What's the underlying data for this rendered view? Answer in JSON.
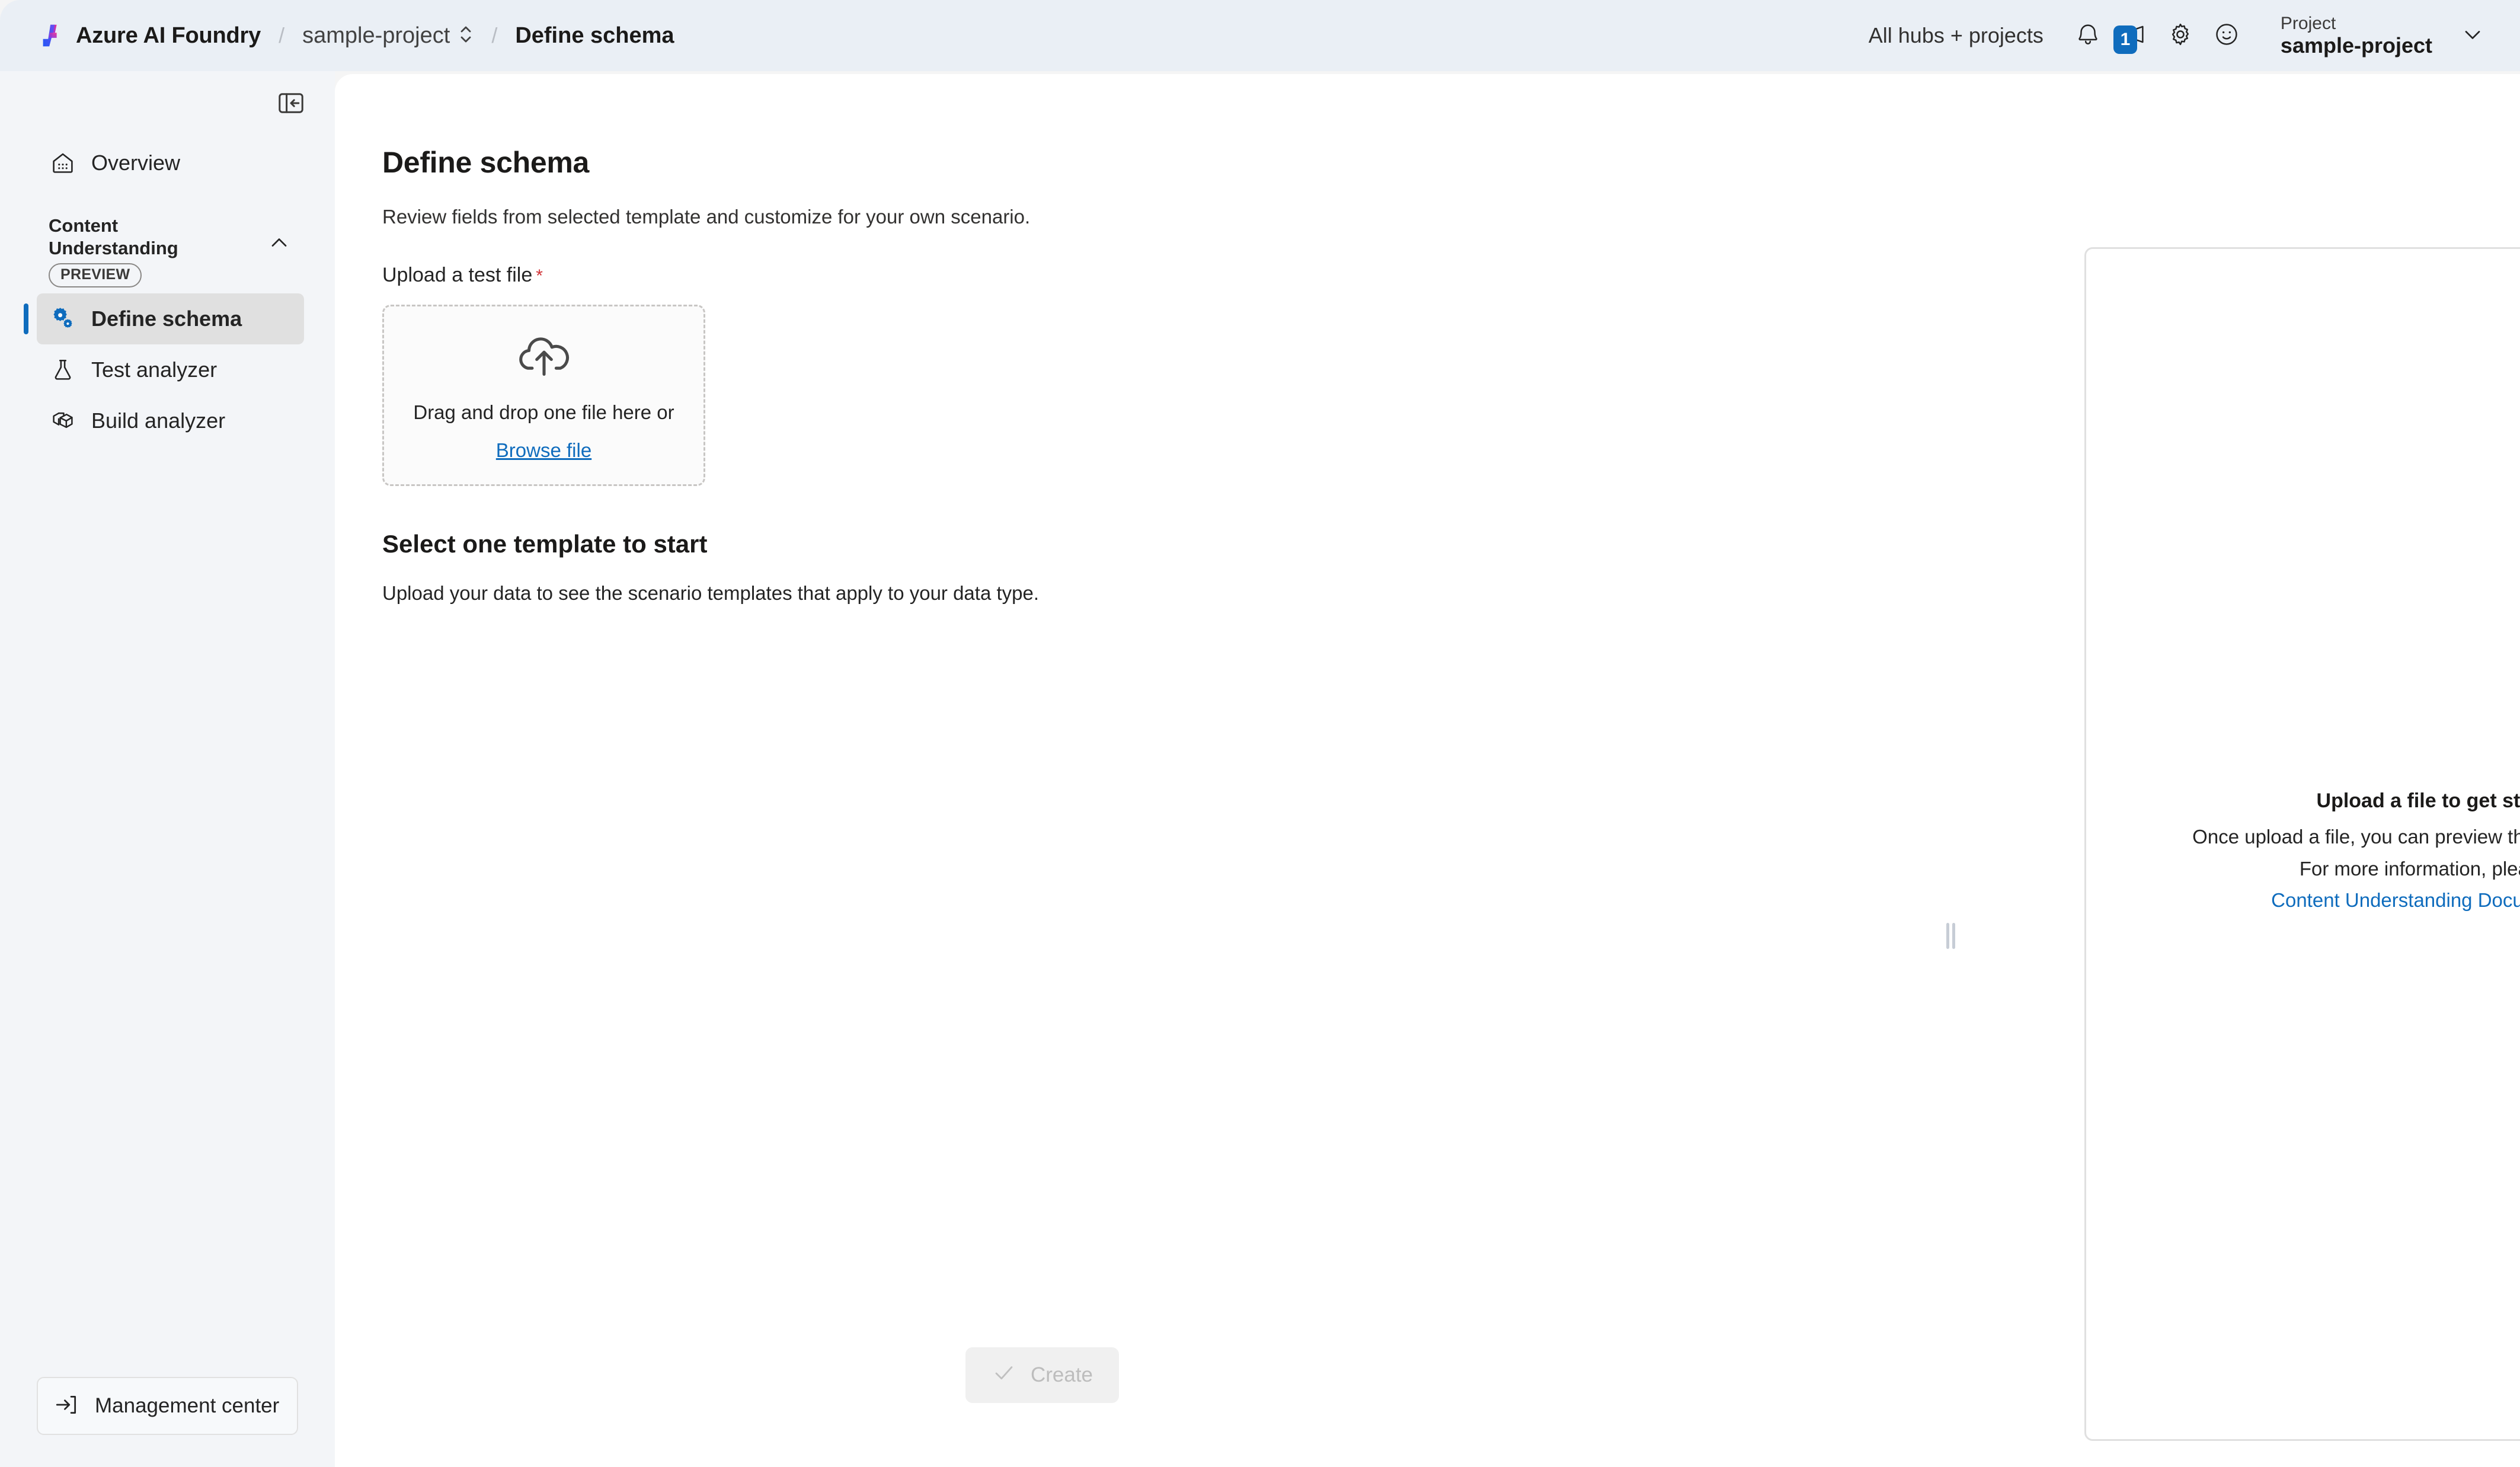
{
  "header": {
    "brand_label": "Azure AI Foundry",
    "brand_icon": "azure-ai-foundry-logo",
    "separator": "/",
    "breadcrumb_project": "sample-project",
    "breadcrumb_project_icon": "chevron-up-down-icon",
    "breadcrumb_current": "Define schema",
    "hubs_link": "All hubs + projects",
    "icons": {
      "notifications": "bell-icon",
      "announcements": "megaphone-icon",
      "settings": "gear-icon",
      "feedback": "smiley-face-icon",
      "project_chevron": "chevron-down-icon"
    },
    "announcements_badge": "1",
    "project_picker": {
      "kicker": "Project",
      "value": "sample-project"
    }
  },
  "sidebar": {
    "collapse_icon": "collapse-panel-icon",
    "overview": {
      "label": "Overview",
      "icon": "home-icon"
    },
    "group": {
      "title": "Content Understanding",
      "badge": "PREVIEW",
      "chevron_icon": "chevron-up-icon"
    },
    "items": [
      {
        "label": "Define schema",
        "icon": "settings-cogs-icon",
        "active": true
      },
      {
        "label": "Test analyzer",
        "icon": "beaker-icon",
        "active": false
      },
      {
        "label": "Build analyzer",
        "icon": "cube-box-icon",
        "active": false
      }
    ],
    "management_center": {
      "label": "Management center",
      "icon": "arrow-right-into-bracket-icon"
    }
  },
  "main": {
    "title": "Define schema",
    "subtitle": "Review fields from selected template and customize for your own scenario.",
    "upload_label": "Upload a test file",
    "required_marker": "*",
    "dropzone": {
      "icon": "cloud-upload-icon",
      "text": "Drag and drop one file here or",
      "browse_link": "Browse file"
    },
    "templates_heading": "Select one template to start",
    "templates_hint": "Upload your data to see the scenario templates that apply to your data type.",
    "create_button": {
      "label": "Create",
      "icon": "checkmark-icon",
      "disabled": true
    }
  },
  "right_panel": {
    "title": "Upload a file to get started",
    "line1": "Once upload a file, you can preview the prebuilt schemas.",
    "line2": "For more information, please see",
    "link": "Content Understanding Documentation."
  },
  "colors": {
    "accent": "#0f6cbd",
    "header_bg": "#eaeff5",
    "sidebar_bg": "#f3f5f8",
    "card_bg": "#ffffff",
    "required": "#d13438",
    "active_nav_bg": "#e0e0e0"
  }
}
